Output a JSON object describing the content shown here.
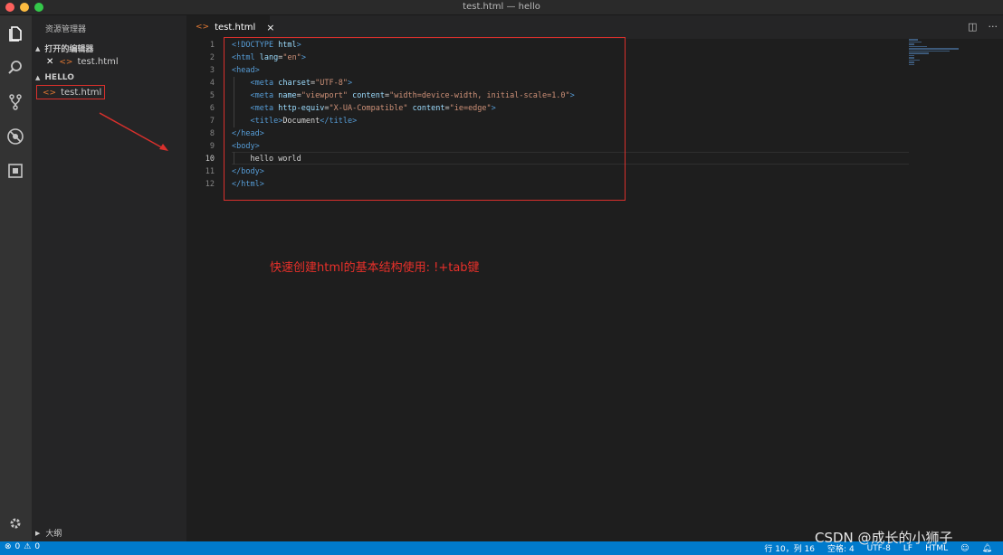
{
  "window": {
    "title": "test.html — hello"
  },
  "sidebar": {
    "title": "资源管理器",
    "open_editors_label": "打开的编辑器",
    "open_editor_file": "test.html",
    "folder_label": "HELLO",
    "folder_file": "test.html",
    "outline_label": "大纲"
  },
  "tab": {
    "tag": "<>",
    "name": "test.html",
    "close": "×"
  },
  "tab_actions": {
    "split": "◫",
    "more": "···"
  },
  "editor": {
    "line_numbers": [
      "1",
      "2",
      "3",
      "4",
      "5",
      "6",
      "7",
      "8",
      "9",
      "10",
      "11",
      "12"
    ],
    "current_line": 10,
    "annotation": "快速创建html的基本结构使用: !+tab键"
  },
  "statusbar": {
    "errors": "0",
    "warnings": "0",
    "position": "行 10，列 16",
    "spaces": "空格: 4",
    "encoding": "UTF-8",
    "eol": "LF",
    "language": "HTML"
  },
  "watermark": "CSDN @成长的小狮子",
  "colors": {
    "accent": "#007acc",
    "highlight": "#d9302c"
  }
}
